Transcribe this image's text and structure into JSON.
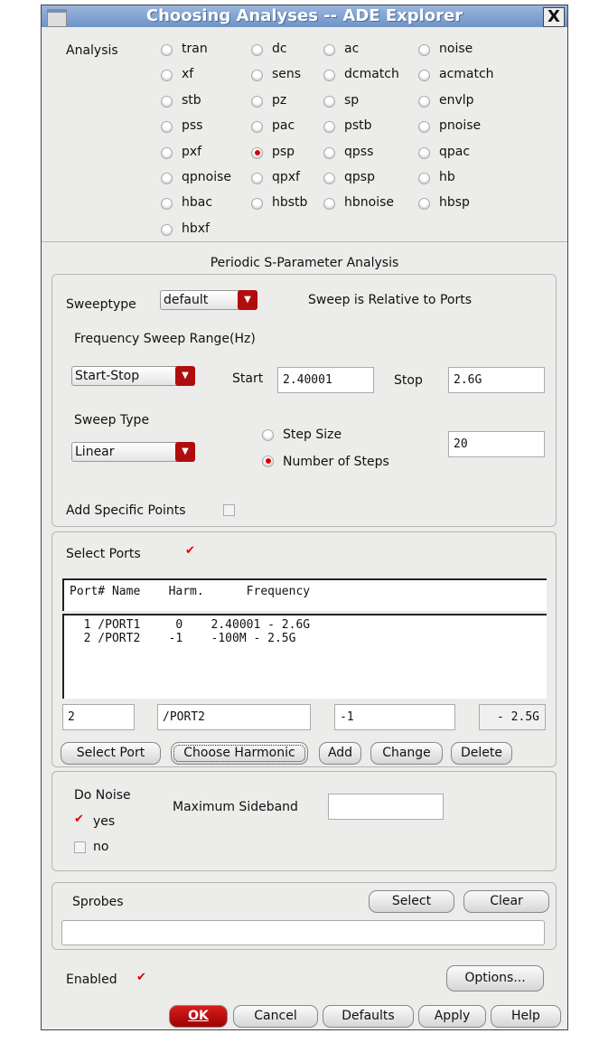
{
  "window": {
    "title": "Choosing Analyses -- ADE Explorer",
    "close": "X"
  },
  "analysis": {
    "label": "Analysis",
    "selected": "psp",
    "options": [
      "tran",
      "dc",
      "ac",
      "noise",
      "xf",
      "sens",
      "dcmatch",
      "acmatch",
      "stb",
      "pz",
      "sp",
      "envlp",
      "pss",
      "pac",
      "pstb",
      "pnoise",
      "pxf",
      "psp",
      "qpss",
      "qpac",
      "qpnoise",
      "qpxf",
      "qpsp",
      "hb",
      "hbac",
      "hbstb",
      "hbnoise",
      "hbsp",
      "hbxf"
    ]
  },
  "psp": {
    "heading": "Periodic S-Parameter Analysis",
    "sweeptype_label": "Sweeptype",
    "sweeptype_value": "default",
    "relative_note": "Sweep is Relative to Ports",
    "freq_range_label": "Frequency Sweep Range(Hz)",
    "range_mode": "Start-Stop",
    "start_label": "Start",
    "start_value": "2.40001",
    "stop_label": "Stop",
    "stop_value": "2.6G",
    "sweep_type_label": "Sweep Type",
    "sweep_type_value": "Linear",
    "step_size_label": "Step Size",
    "num_steps_label": "Number of Steps",
    "num_steps_value": "20",
    "step_mode": "Number of Steps",
    "add_points_label": "Add Specific Points",
    "add_points_checked": false
  },
  "ports": {
    "select_label": "Select Ports",
    "select_checked": true,
    "header": "Port# Name    Harm.      Frequency",
    "rows": [
      "  1 /PORT1     0    2.40001 - 2.6G",
      "  2 /PORT2    -1    -100M - 2.5G"
    ],
    "edit_port": "2",
    "edit_name": "/PORT2",
    "edit_harm": "-1",
    "edit_freq": "- 2.5G",
    "buttons": {
      "select_port": "Select Port",
      "choose_harmonic": "Choose Harmonic",
      "add": "Add",
      "change": "Change",
      "delete": "Delete"
    }
  },
  "noise": {
    "do_noise_label": "Do Noise",
    "yes": "yes",
    "no": "no",
    "yes_checked": true,
    "max_sideband_label": "Maximum Sideband",
    "max_sideband_value": ""
  },
  "sprobes": {
    "label": "Sprobes",
    "select": "Select",
    "clear": "Clear",
    "value": ""
  },
  "enabled": {
    "label": "Enabled",
    "checked": true
  },
  "options_button": "Options...",
  "footer": {
    "ok": "OK",
    "cancel": "Cancel",
    "defaults": "Defaults",
    "apply": "Apply",
    "help": "Help"
  }
}
